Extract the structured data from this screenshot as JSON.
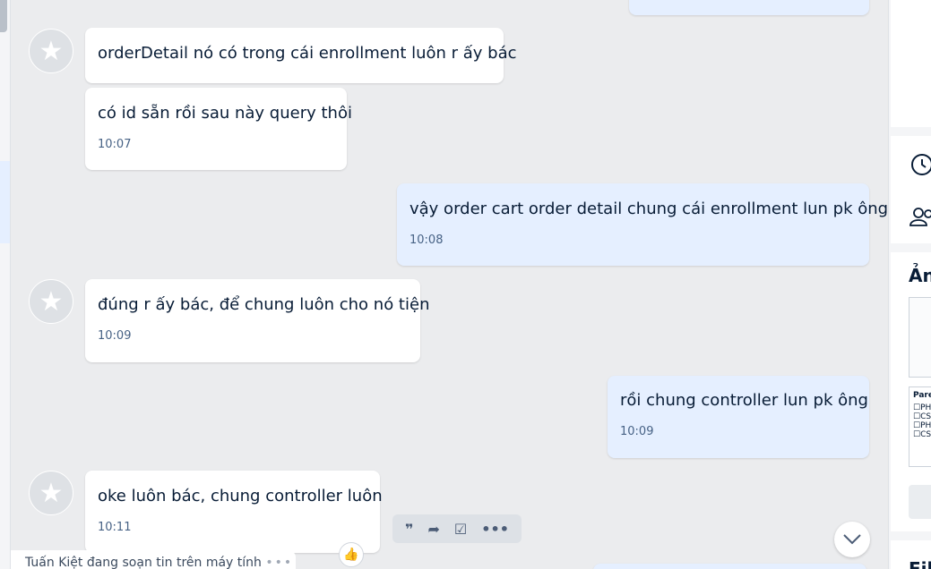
{
  "messages": [
    {
      "text": "orderDetail nó có trong cái enrollment luôn r ấy bác",
      "time": ""
    },
    {
      "text": "có id sẵn rồi sau này query thôi",
      "time": "10:07"
    },
    {
      "text": "vậy order cart order detail chung cái enrollment lun pk ông",
      "time": "10:08"
    },
    {
      "text": "đúng r ấy bác, để chung luôn cho nó tiện",
      "time": "10:09"
    },
    {
      "text": "rồi chung controller lun pk ông",
      "time": "10:09"
    },
    {
      "text": "oke luôn bác, chung controller luôn",
      "time": "10:11"
    }
  ],
  "typing_indicator": "Tuấn Kiệt đang soạn tin trên máy tính",
  "right_panel": {
    "media_title": "Ảnh",
    "files_title": "File",
    "doc_preview_heading": "Pare",
    "doc_preview_items": [
      "PH",
      "CS",
      "PH",
      "CS"
    ]
  },
  "colors": {
    "outgoing_bubble": "#e5efff",
    "incoming_bubble": "#ffffff",
    "chat_background": "#ebecee"
  }
}
